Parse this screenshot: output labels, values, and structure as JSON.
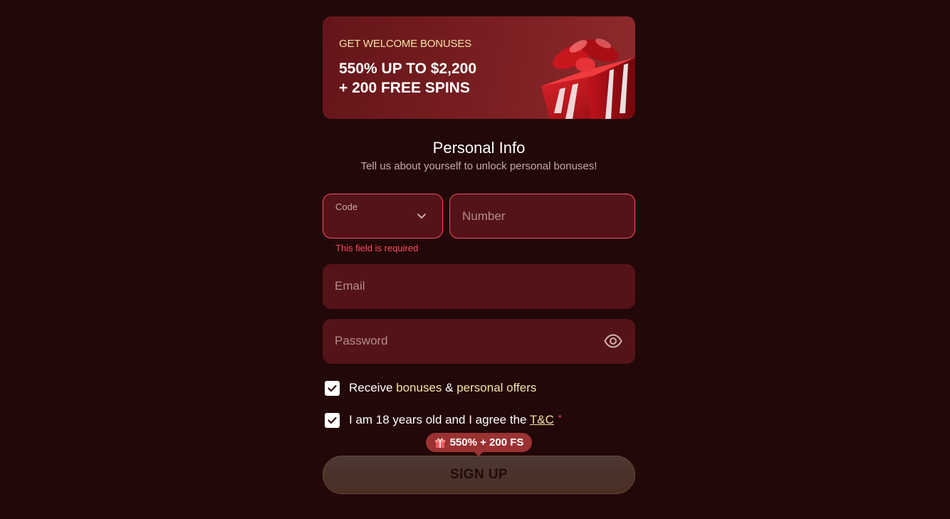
{
  "banner": {
    "subtitle": "GET WELCOME BONUSES",
    "title": "550% UP TO $2,200\n+ 200 FREE SPINS"
  },
  "section": {
    "title": "Personal Info",
    "subtitle": "Tell us about yourself to unlock personal bonuses!"
  },
  "form": {
    "code_label": "Code",
    "code_value": "",
    "number_placeholder": "Number",
    "error_required": "This field is required",
    "email_placeholder": "Email",
    "password_placeholder": "Password"
  },
  "consents": {
    "bonuses_prefix": "Receive ",
    "bonuses_link1": "bonuses",
    "bonuses_middle": " & ",
    "bonuses_link2": "personal offers",
    "bonuses_checked": true,
    "age_text": "I am 18 years old and I agree the ",
    "age_link": "T&C",
    "age_required": "*",
    "age_checked": true
  },
  "badge": {
    "text": "550% + 200 FS"
  },
  "signup": {
    "label": "SIGN UP"
  },
  "colors": {
    "background": "#220808",
    "field": "#541317",
    "error": "#ff4d5f",
    "accent": "#f3e3a2",
    "badge": "#9b3232"
  }
}
